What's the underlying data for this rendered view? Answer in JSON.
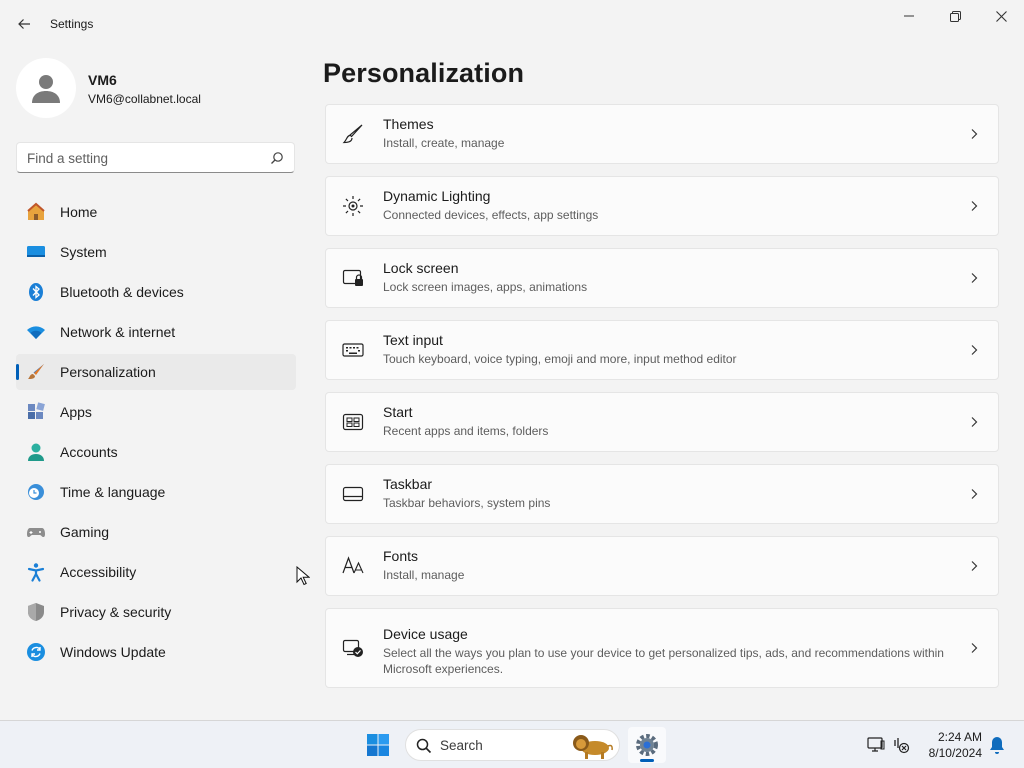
{
  "window": {
    "title": "Settings"
  },
  "profile": {
    "name": "VM6",
    "email": "VM6@collabnet.local"
  },
  "search": {
    "placeholder": "Find a setting"
  },
  "nav": {
    "items": [
      {
        "label": "Home",
        "icon": "home-icon"
      },
      {
        "label": "System",
        "icon": "system-icon"
      },
      {
        "label": "Bluetooth & devices",
        "icon": "bluetooth-icon"
      },
      {
        "label": "Network & internet",
        "icon": "wifi-icon"
      },
      {
        "label": "Personalization",
        "icon": "brush-icon",
        "active": true
      },
      {
        "label": "Apps",
        "icon": "apps-icon"
      },
      {
        "label": "Accounts",
        "icon": "accounts-icon"
      },
      {
        "label": "Time & language",
        "icon": "globe-clock-icon"
      },
      {
        "label": "Gaming",
        "icon": "gamepad-icon"
      },
      {
        "label": "Accessibility",
        "icon": "accessibility-icon"
      },
      {
        "label": "Privacy & security",
        "icon": "shield-icon"
      },
      {
        "label": "Windows Update",
        "icon": "update-icon"
      }
    ]
  },
  "page": {
    "title": "Personalization"
  },
  "cards": [
    {
      "title": "Themes",
      "subtitle": "Install, create, manage",
      "icon": "paintbrush-icon"
    },
    {
      "title": "Dynamic Lighting",
      "subtitle": "Connected devices, effects, app settings",
      "icon": "lighting-icon"
    },
    {
      "title": "Lock screen",
      "subtitle": "Lock screen images, apps, animations",
      "icon": "lock-screen-icon"
    },
    {
      "title": "Text input",
      "subtitle": "Touch keyboard, voice typing, emoji and more, input method editor",
      "icon": "keyboard-icon"
    },
    {
      "title": "Start",
      "subtitle": "Recent apps and items, folders",
      "icon": "start-icon"
    },
    {
      "title": "Taskbar",
      "subtitle": "Taskbar behaviors, system pins",
      "icon": "taskbar-icon"
    },
    {
      "title": "Fonts",
      "subtitle": "Install, manage",
      "icon": "fonts-icon"
    },
    {
      "title": "Device usage",
      "subtitle": "Select all the ways you plan to use your device to get personalized tips, ads, and recommendations within Microsoft experiences.",
      "icon": "device-usage-icon"
    }
  ],
  "taskbar": {
    "search_label": "Search",
    "time": "2:24 AM",
    "date": "8/10/2024"
  },
  "colors": {
    "accent": "#005fb8",
    "background": "#f3f3f3",
    "card": "#fbfbfb"
  }
}
